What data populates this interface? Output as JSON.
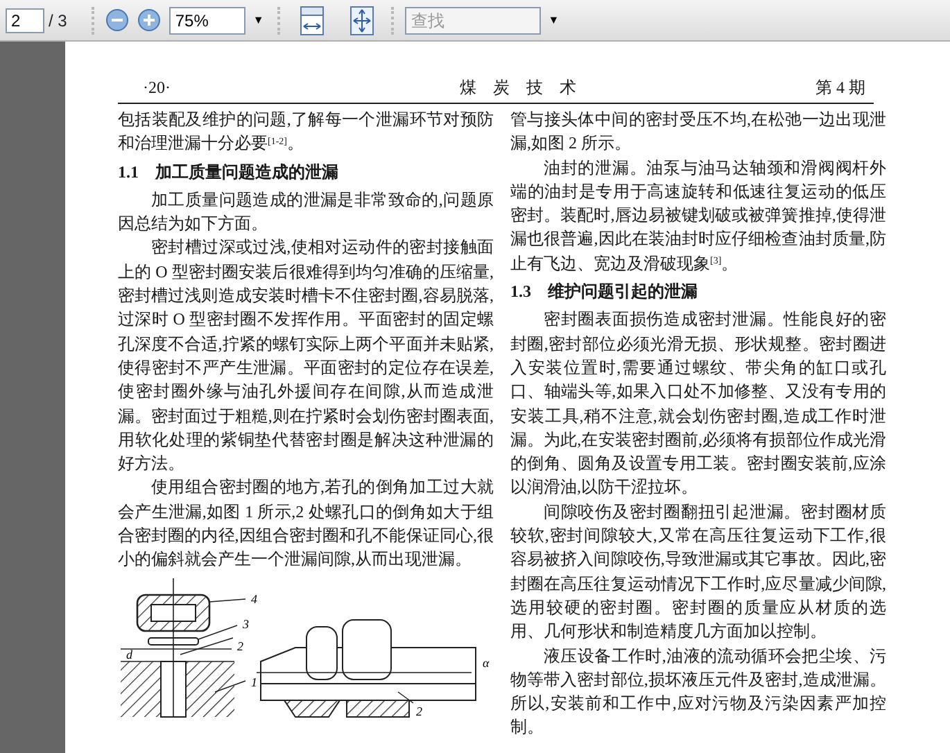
{
  "toolbar": {
    "page_number": "2",
    "page_count": "/ 3",
    "zoom": "75%",
    "zoom_arrow": "▼",
    "search_arrow": "▼",
    "search": {
      "placeholder": "查找"
    }
  },
  "page": {
    "header": {
      "page_label": "·20·",
      "journal": "煤　炭　技　术",
      "issue": "第 4 期"
    },
    "columns": [
      {
        "blocks": [
          {
            "kind": "paragraph",
            "indent": false,
            "text": "包括装配及维护的问题,了解每一个泄漏环节对预防和治理泄漏十分必要$^{[1-2]}$。"
          },
          {
            "kind": "heading",
            "indent": false,
            "text": "1.1　加工质量问题造成的泄漏"
          },
          {
            "kind": "paragraph",
            "indent": true,
            "text": "加工质量问题造成的泄漏是非常致命的,问题原因总结为如下方面。"
          },
          {
            "kind": "paragraph",
            "indent": true,
            "text": "密封槽过深或过浅,使相对运动件的密封接触面上的 O 型密封圈安装后很难得到均匀准确的压缩量,密封槽过浅则造成安装时槽卡不住密封圈,容易脱落,过深时 O 型密封圈不发挥作用。平面密封的固定螺孔深度不合适,拧紧的螺钉实际上两个平面并未贴紧,使得密封不严产生泄漏。平面密封的定位存在误差,使密封圈外缘与油孔外援间存在间隙,从而造成泄漏。密封面过于粗糙,则在拧紧时会划伤密封圈表面,用软化处理的紫铜垫代替密封圈是解决这种泄漏的好方法。"
          },
          {
            "kind": "paragraph",
            "indent": true,
            "text": "使用组合密封圈的地方,若孔的倒角加工过大就会产生泄漏,如图 1 所示,2 处螺孔口的倒角如大于组合密封圈的内径,因组合密封圈和孔不能保证同心,很小的偏斜就会产生一个泄漏间隙,从而出现泄漏。"
          },
          {
            "kind": "figures",
            "figures": [
              {
                "labels": [
                  "4",
                  "3",
                  "2",
                  "d",
                  "1"
                ]
              },
              {
                "labels": [
                  "α",
                  "2"
                ]
              }
            ]
          }
        ]
      },
      {
        "blocks": [
          {
            "kind": "paragraph",
            "indent": false,
            "text": "管与接头体中间的密封受压不均,在松弛一边出现泄漏,如图 2 所示。"
          },
          {
            "kind": "paragraph",
            "indent": true,
            "text": "油封的泄漏。油泵与油马达轴颈和滑阀阀杆外端的油封是专用于高速旋转和低速往复运动的低压密封。装配时,唇边易被键划破或被弹簧推掉,使得泄漏也很普遍,因此在装油封时应仔细检查油封质量,防止有飞边、宽边及滑破现象$^{[3]}$。"
          },
          {
            "kind": "heading",
            "indent": false,
            "text": "1.3　维护问题引起的泄漏"
          },
          {
            "kind": "paragraph",
            "indent": true,
            "text": "密封圈表面损伤造成密封泄漏。性能良好的密封圈,密封部位必须光滑无损、形状规整。密封圈进入安装位置时,需要通过螺纹、带尖角的缸口或孔口、轴端头等,如果入口处不加修整、又没有专用的安装工具,稍不注意,就会划伤密封圈,造成工作时泄漏。为此,在安装密封圈前,必须将有损部位作成光滑的倒角、圆角及设置专用工装。密封圈安装前,应涂以润滑油,以防干涩拉坏。"
          },
          {
            "kind": "paragraph",
            "indent": true,
            "text": "间隙咬伤及密封圈翻扭引起泄漏。密封圈材质较软,密封间隙较大,又常在高压往复运动下工作,很容易被挤入间隙咬伤,导致泄漏或其它事故。因此,密封圈在高压往复运动情况下工作时,应尽量减少间隙,选用较硬的密封圈。密封圈的质量应从材质的选用、几何形状和制造精度几方面加以控制。"
          },
          {
            "kind": "paragraph",
            "indent": true,
            "text": "液压设备工作时,油液的流动循环会把尘埃、污物等带入密封部位,损坏液压元件及密封,造成泄漏。所以,安装前和工作中,应对污物及污染因素严加控制。"
          }
        ]
      }
    ]
  }
}
